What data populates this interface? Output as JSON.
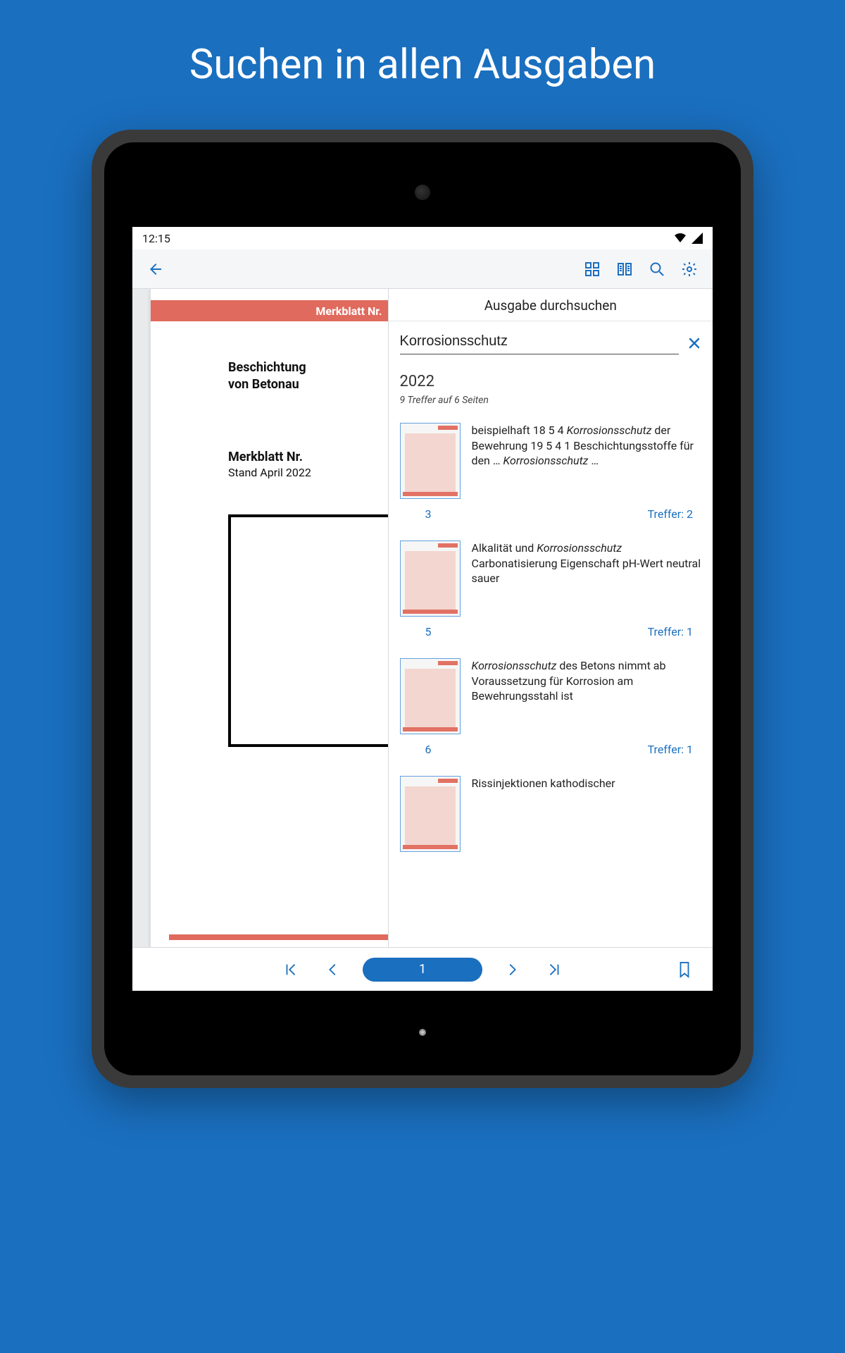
{
  "promo": {
    "title": "Suchen in allen Ausgaben"
  },
  "status": {
    "time": "12:15"
  },
  "document": {
    "red_band_label": "Merkblatt Nr.",
    "title_line_1": "Beschichtung",
    "title_line_2": "von Betonau",
    "subtitle": "Merkblatt Nr.",
    "subtitle_stand": "Stand April 2022"
  },
  "search": {
    "panel_title": "Ausgabe durchsuchen",
    "query": "Korrosionsschutz",
    "year": "2022",
    "summary": "9 Treffer auf 6 Seiten",
    "hits_label": "Treffer:",
    "results": [
      {
        "page": "3",
        "hits": "2",
        "snippet_html": "beispielhaft 18 5 4 <em>Korrosionsschutz</em> der Bewehrung 19 5 4 1 Beschichtungsstoffe für den … <em>Korrosionsschutz</em> …"
      },
      {
        "page": "5",
        "hits": "1",
        "snippet_html": "Alkalität und <em>Korrosionsschutz</em> Carbonatisierung Eigenschaft pH-Wert neutral sauer"
      },
      {
        "page": "6",
        "hits": "1",
        "snippet_html": "<em>Korrosionsschutz</em> des Betons nimmt ab Voraussetzung für Korrosion am Bewehrungsstahl ist"
      },
      {
        "page": "",
        "hits": "",
        "snippet_html": "Rissinjektionen kathodischer"
      }
    ]
  },
  "pager": {
    "current_page": "1"
  }
}
